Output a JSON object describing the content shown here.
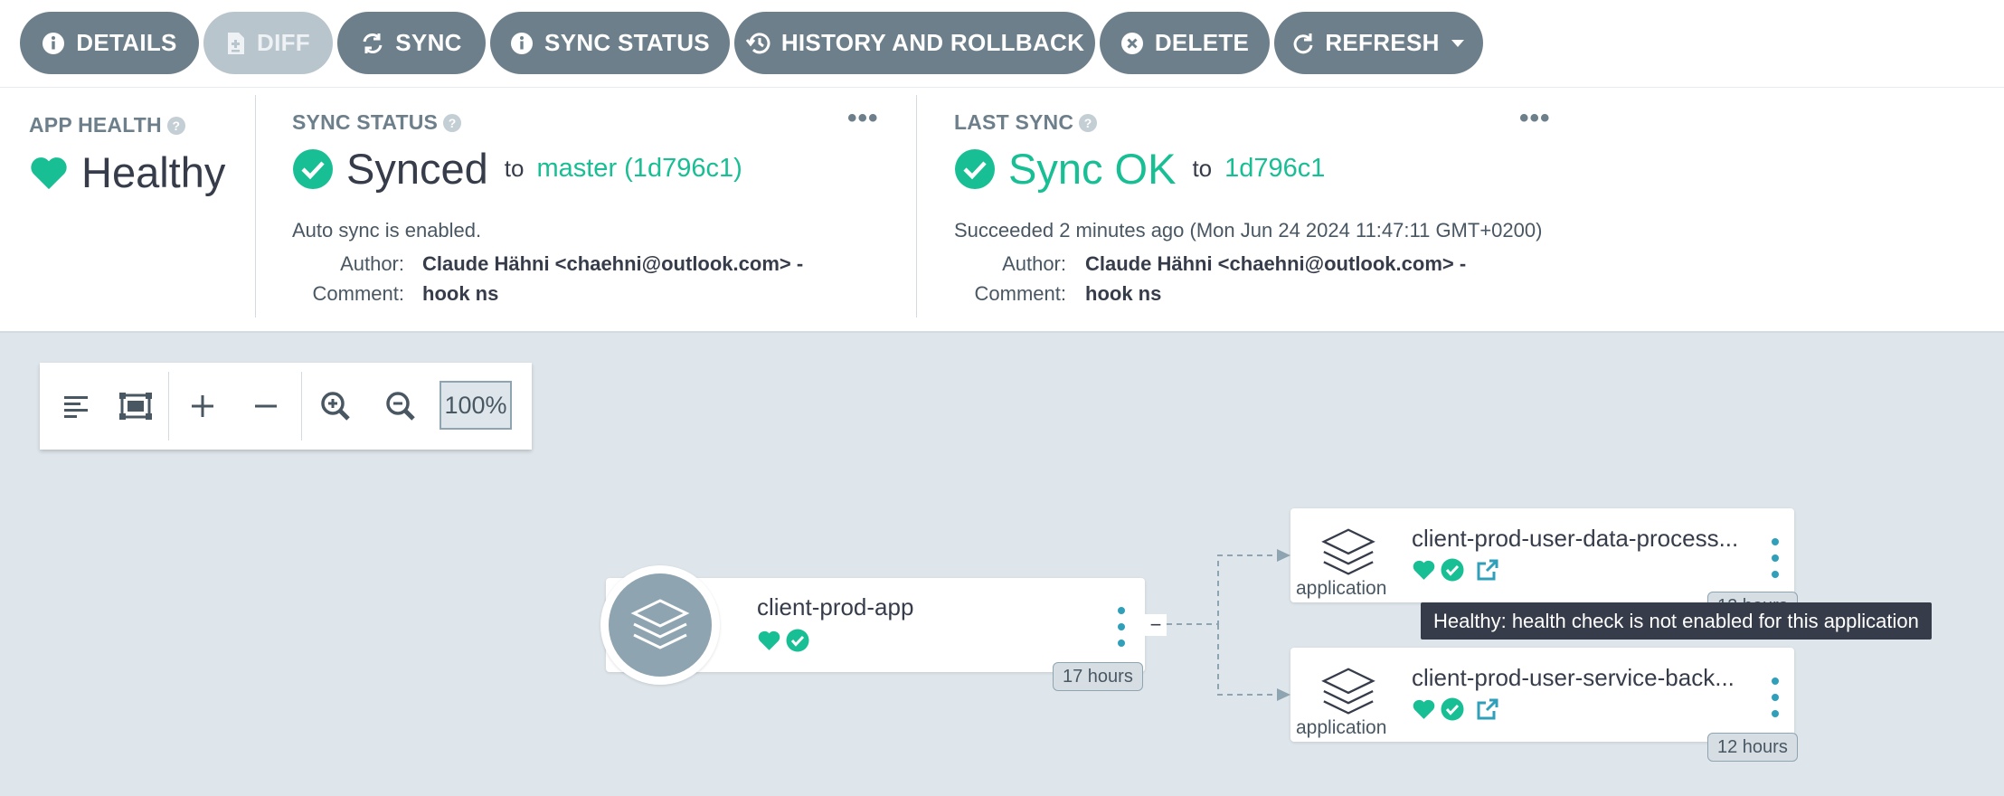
{
  "toolbar": {
    "details": "DETAILS",
    "diff": "DIFF",
    "sync": "SYNC",
    "sync_status": "SYNC STATUS",
    "history": "HISTORY AND ROLLBACK",
    "delete": "DELETE",
    "refresh": "REFRESH"
  },
  "app_health": {
    "title": "APP HEALTH",
    "status": "Healthy"
  },
  "sync_status": {
    "title": "SYNC STATUS",
    "status": "Synced",
    "to": "to",
    "revision": "master (1d796c1)",
    "auto_sync": "Auto sync is enabled.",
    "author_label": "Author:",
    "author": "Claude Hähni <chaehni@outlook.com> -",
    "comment_label": "Comment:",
    "comment": "hook ns"
  },
  "last_sync": {
    "title": "LAST SYNC",
    "status": "Sync OK",
    "to": "to",
    "revision": "1d796c1",
    "succeeded": "Succeeded 2 minutes ago (Mon Jun 24 2024 11:47:11 GMT+0200)",
    "author_label": "Author:",
    "author": "Claude Hähni <chaehni@outlook.com> -",
    "comment_label": "Comment:",
    "comment": "hook ns"
  },
  "graph": {
    "zoom": "100%",
    "root": {
      "name": "client-prod-app",
      "age": "17 hours"
    },
    "children": [
      {
        "name": "client-prod-user-data-process...",
        "kind": "application",
        "age": "12 hours"
      },
      {
        "name": "client-prod-user-service-back...",
        "kind": "application",
        "age": "12 hours"
      }
    ],
    "collapse_symbol": "−",
    "tooltip": "Healthy: health check is not enabled for this application"
  },
  "colors": {
    "accent_green": "#18be94",
    "button_gray": "#6d7f8b",
    "link_blue": "#2f9fba",
    "background": "#dee6eb"
  },
  "icons": [
    "info-icon",
    "file-diff-icon",
    "sync-icon",
    "history-icon",
    "close-circle-icon",
    "refresh-icon",
    "caret-down-icon",
    "heart-icon",
    "check-circle-icon",
    "help-icon",
    "layers-icon",
    "external-link-icon"
  ]
}
